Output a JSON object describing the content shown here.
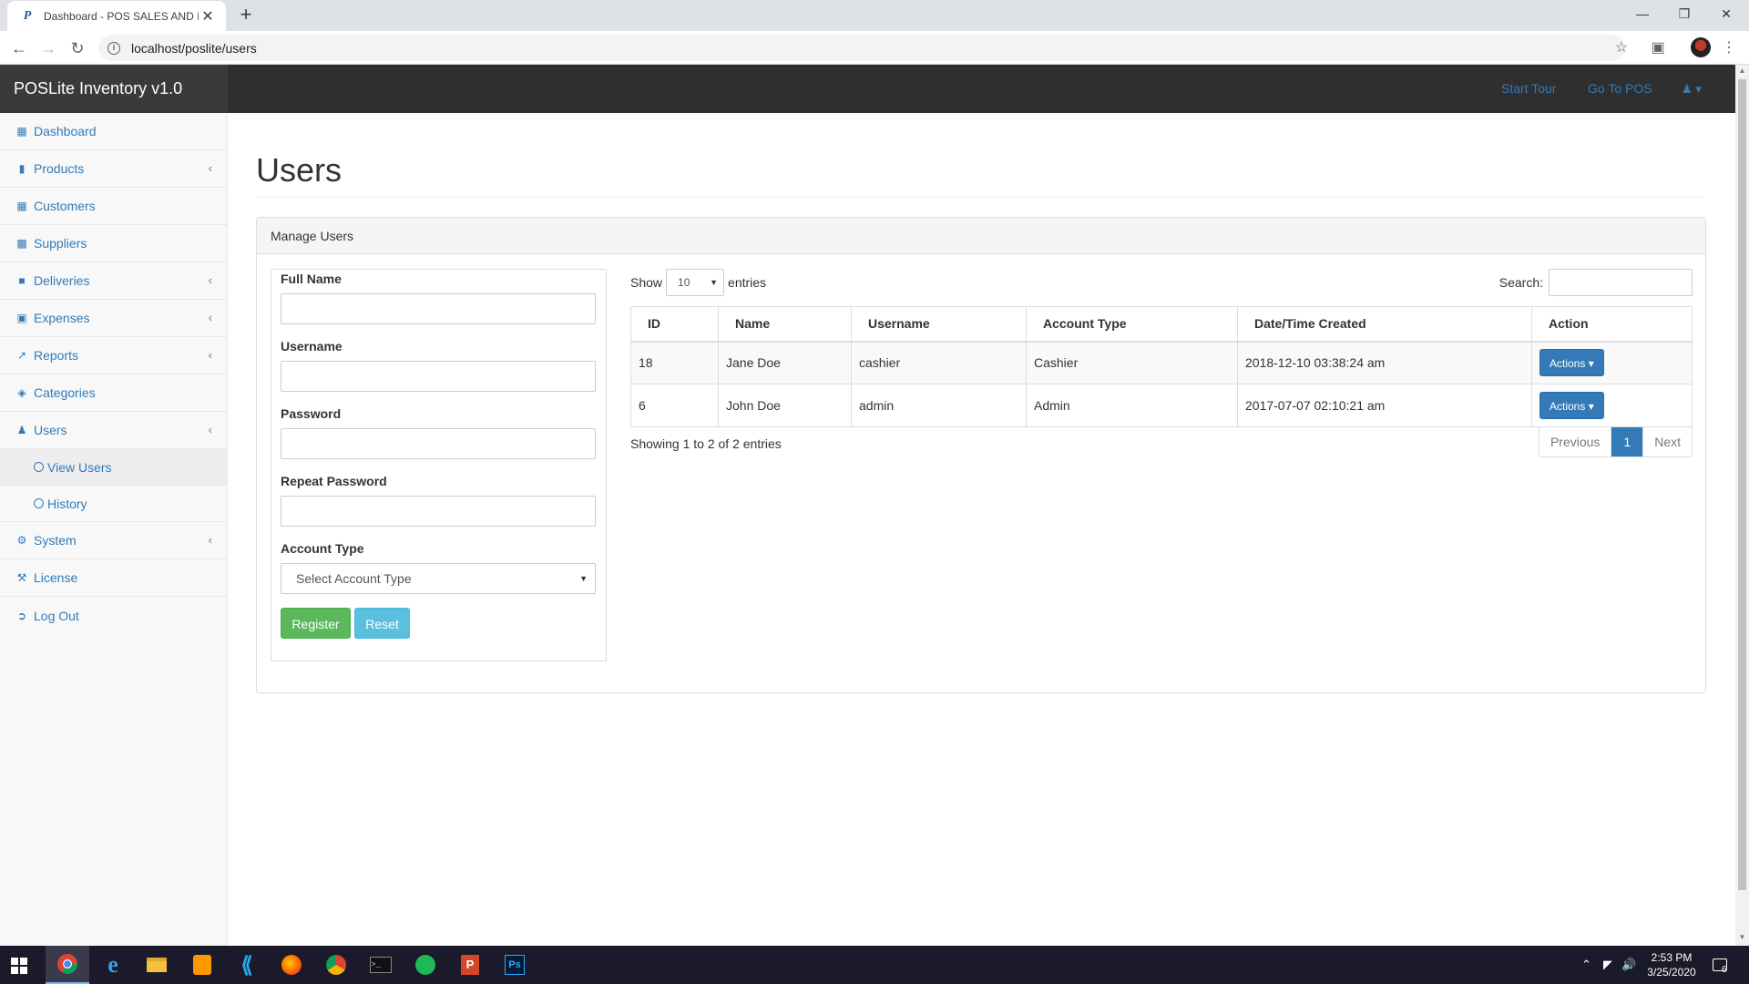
{
  "browser": {
    "tab_title": "Dashboard - POS SALES AND IN",
    "tab_favicon": "P",
    "url": "localhost/poslite/users",
    "close_glyph": "✕",
    "newtab_glyph": "+"
  },
  "navbar": {
    "brand": "POSLite Inventory v1.0",
    "start_tour": "Start Tour",
    "go_to_pos": "Go To POS"
  },
  "sidebar": {
    "items": [
      {
        "label": "Dashboard",
        "icon": "table-icon",
        "chevron": false
      },
      {
        "label": "Products",
        "icon": "folder-icon",
        "chevron": true
      },
      {
        "label": "Customers",
        "icon": "table-icon",
        "chevron": false
      },
      {
        "label": "Suppliers",
        "icon": "bar-chart-icon",
        "chevron": false
      },
      {
        "label": "Deliveries",
        "icon": "truck-icon",
        "chevron": true
      },
      {
        "label": "Expenses",
        "icon": "money-icon",
        "chevron": true
      },
      {
        "label": "Reports",
        "icon": "line-chart-icon",
        "chevron": true
      },
      {
        "label": "Categories",
        "icon": "tags-icon",
        "chevron": false
      },
      {
        "label": "Users",
        "icon": "users-icon",
        "chevron": true
      },
      {
        "label": "System",
        "icon": "gear-icon",
        "chevron": true
      },
      {
        "label": "License",
        "icon": "gavel-icon",
        "chevron": false
      },
      {
        "label": "Log Out",
        "icon": "sign-out-icon",
        "chevron": false
      }
    ],
    "users_sub": [
      {
        "label": "View Users",
        "active": true
      },
      {
        "label": "History",
        "active": false
      }
    ]
  },
  "page": {
    "title": "Users",
    "panel_heading": "Manage Users"
  },
  "form": {
    "full_name_label": "Full Name",
    "username_label": "Username",
    "password_label": "Password",
    "repeat_password_label": "Repeat Password",
    "account_type_label": "Account Type",
    "account_type_selected": "Select Account Type",
    "register": "Register",
    "reset": "Reset"
  },
  "table": {
    "show_label": "Show",
    "entries_label": "entries",
    "page_length": "10",
    "search_label": "Search:",
    "columns": [
      "ID",
      "Name",
      "Username",
      "Account Type",
      "Date/Time Created",
      "Action"
    ],
    "rows": [
      {
        "id": "18",
        "name": "Jane Doe",
        "username": "cashier",
        "account_type": "Cashier",
        "created": "2018-12-10 03:38:24 am",
        "action": "Actions"
      },
      {
        "id": "6",
        "name": "John Doe",
        "username": "admin",
        "account_type": "Admin",
        "created": "2017-07-07 02:10:21 am",
        "action": "Actions"
      }
    ],
    "info": "Showing 1 to 2 of 2 entries",
    "prev": "Previous",
    "page": "1",
    "next": "Next"
  },
  "taskbar": {
    "time": "2:53 PM",
    "date": "3/25/2020",
    "notification_count": "6"
  },
  "colors": {
    "link": "#337ab7",
    "navbar": "#2f2f2f",
    "success": "#5cb85c",
    "info": "#5bc0de",
    "primary": "#337ab7"
  }
}
